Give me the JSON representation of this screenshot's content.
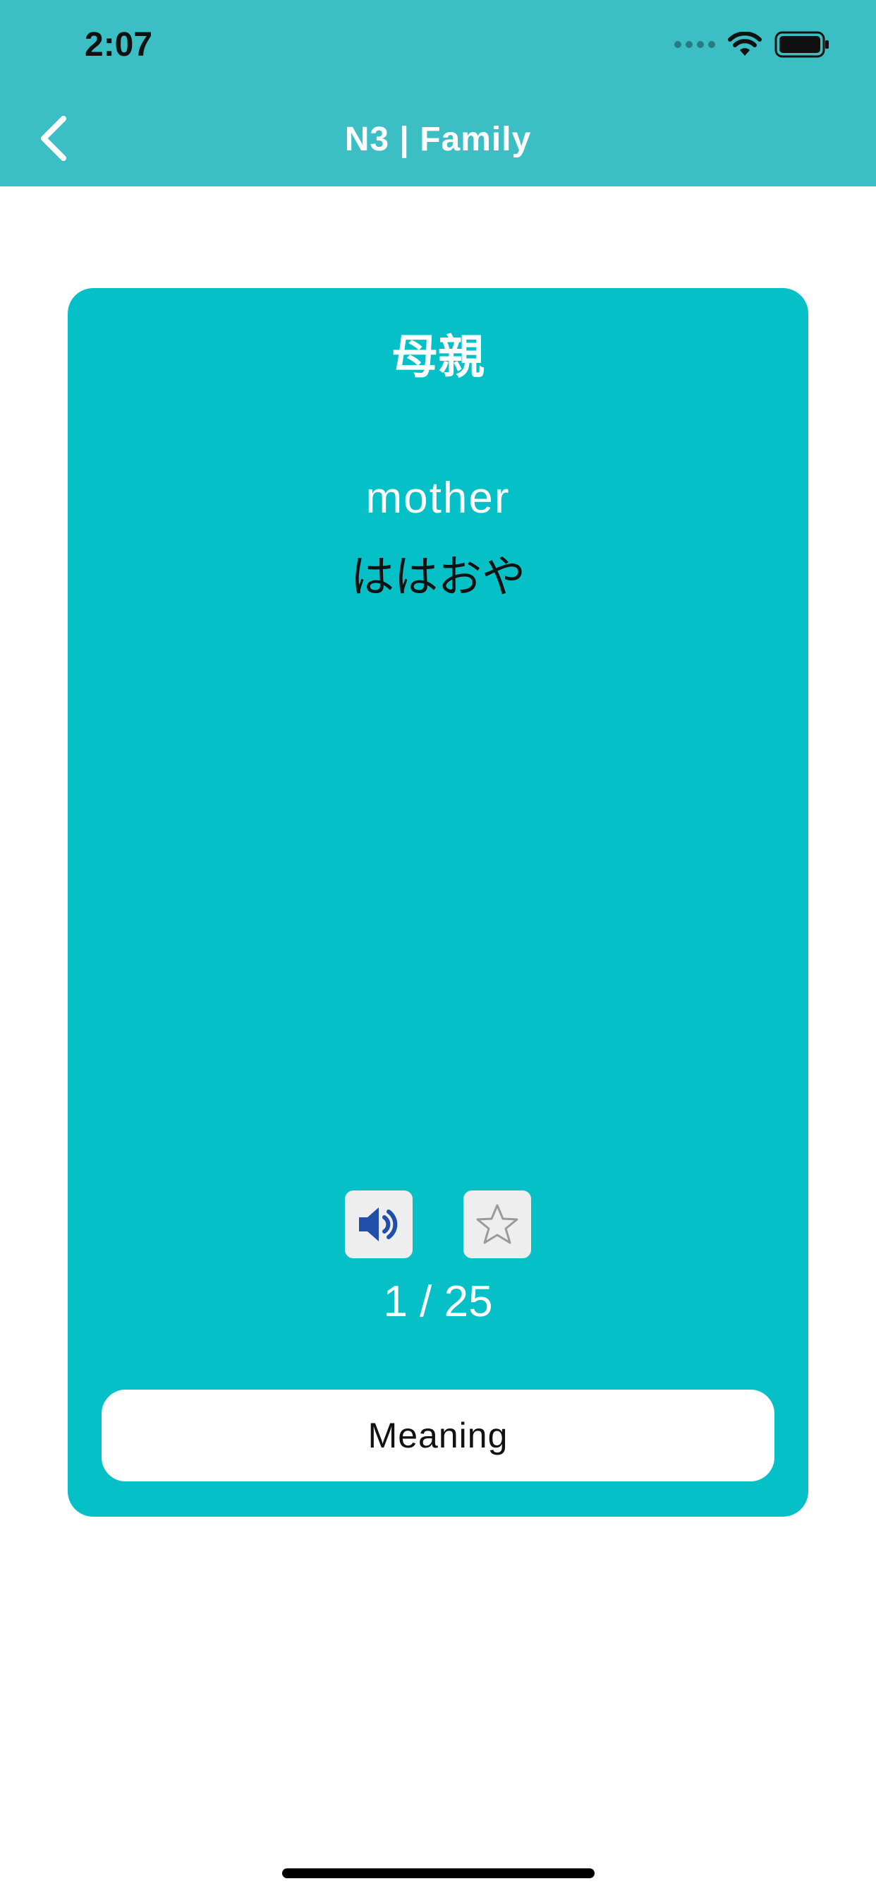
{
  "status_bar": {
    "time": "2:07"
  },
  "nav": {
    "title": "N3 | Family"
  },
  "card": {
    "kanji": "母親",
    "meaning": "mother",
    "reading": "ははおや",
    "counter": "1 / 25",
    "meaning_button_label": "Meaning"
  },
  "colors": {
    "header_bg": "#3cbfc4",
    "card_bg": "#05c0c7",
    "sound_icon": "#1f4fa6"
  },
  "icons": {
    "back": "chevron-left-icon",
    "sound": "speaker-icon",
    "favorite": "star-outline-icon"
  }
}
